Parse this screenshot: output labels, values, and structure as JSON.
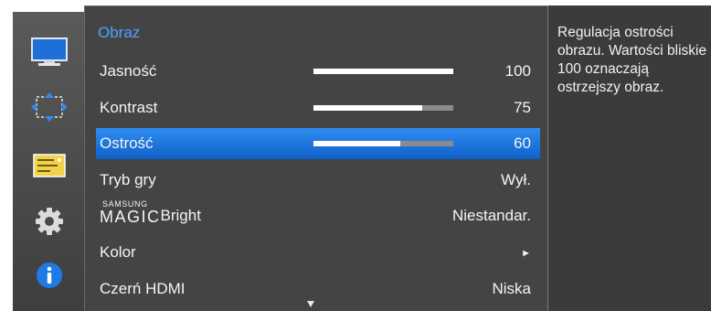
{
  "sidebar": {
    "icons": [
      {
        "name": "picture-monitor-icon",
        "active": true
      },
      {
        "name": "screen-adjust-icon",
        "active": false
      },
      {
        "name": "picture-in-picture-icon",
        "active": false
      },
      {
        "name": "gear-icon",
        "active": false
      },
      {
        "name": "info-icon",
        "active": false
      }
    ]
  },
  "menu": {
    "title": "Obraz",
    "items": [
      {
        "label": "Jasność",
        "value": "100",
        "level": 1.0
      },
      {
        "label": "Kontrast",
        "value": "75",
        "level": 0.78
      },
      {
        "label": "Ostrość",
        "value": "60",
        "level": 0.62
      },
      {
        "label": "Tryb gry",
        "value": "Wył."
      },
      {
        "label_brand_top": "SAMSUNG",
        "label_brand": "MAGIC",
        "label": "Bright",
        "value": "Niestandar."
      },
      {
        "label": "Kolor",
        "value": "►"
      },
      {
        "label": "Czerń HDMI",
        "value": "Niska"
      }
    ],
    "selected_index": 2,
    "scroll_indicator": "down-arrow-icon"
  },
  "description": {
    "text": "Regulacja ostrości obrazu. Wartości bliskie 100 oznaczają ostrzejszy obraz."
  },
  "colors": {
    "accent": "#2f8cf0",
    "title": "#4aa3ff",
    "panel_bg": "#444444",
    "rail_bg": "#4a4a4a"
  }
}
